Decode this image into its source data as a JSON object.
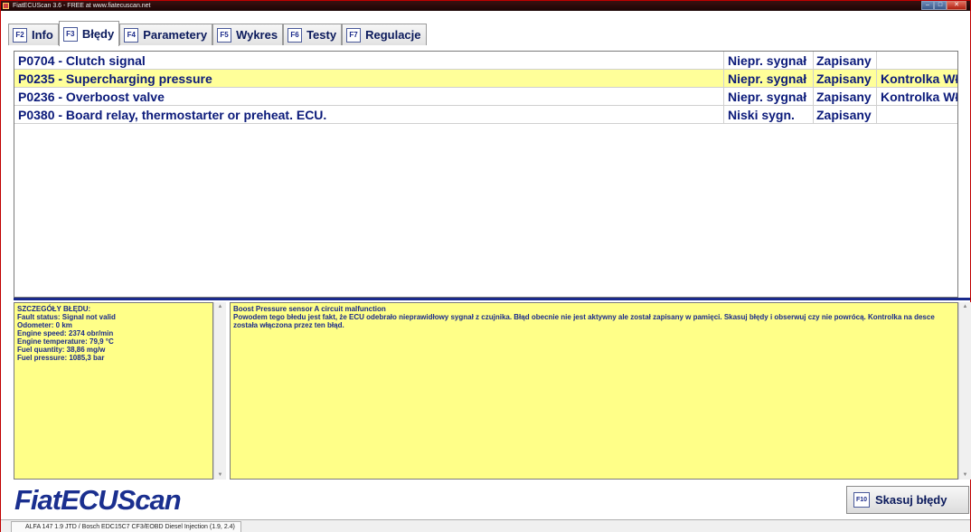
{
  "window": {
    "title": "FiatECUScan 3.6 - FREE at www.fiatecuscan.net",
    "buttons": [
      "minimize",
      "maximize",
      "close"
    ]
  },
  "tabs": [
    {
      "key": "F2",
      "label": "Info"
    },
    {
      "key": "F3",
      "label": "Błędy"
    },
    {
      "key": "F4",
      "label": "Parametery"
    },
    {
      "key": "F5",
      "label": "Wykres"
    },
    {
      "key": "F6",
      "label": "Testy"
    },
    {
      "key": "F7",
      "label": "Regulacje"
    }
  ],
  "active_tab": "Błędy",
  "errors": [
    {
      "code_desc": "P0704 - Clutch signal",
      "signal": "Niepr. sygnał",
      "status": "Zapisany",
      "lamp": ""
    },
    {
      "code_desc": "P0235 - Supercharging pressure",
      "signal": "Niepr. sygnał",
      "status": "Zapisany",
      "lamp": "Kontrolka WŁ"
    },
    {
      "code_desc": "P0236 - Overboost valve",
      "signal": "Niepr. sygnał",
      "status": "Zapisany",
      "lamp": "Kontrolka WŁ"
    },
    {
      "code_desc": "P0380 - Board relay, thermostarter or preheat. ECU.",
      "signal": "Niski sygn.",
      "status": "Zapisany",
      "lamp": ""
    }
  ],
  "selected_error_index": 1,
  "details": {
    "header": "SZCZEGÓŁY BŁĘDU:",
    "lines": [
      "Fault status: Signal not valid",
      "Odometer: 0 km",
      "Engine speed: 2374 obr/min",
      "Engine temperature: 79,9 °C",
      "Fuel quantity: 38,86 mg/w",
      "Fuel pressure: 1085,3 bar"
    ]
  },
  "description": {
    "title": "Boost Pressure sensor A circuit malfunction",
    "text": "Powodem tego błedu jest fakt, że ECU odebrało nieprawidłowy sygnał z czujnika. Błąd obecnie nie jest aktywny ale został zapisany w pamięci. Skasuj błędy i obserwuj czy nie powrócą. Kontrolka na desce została włączona przez ten błąd."
  },
  "logo": "FiatECUScan",
  "clear_button": {
    "key": "F10",
    "label": "Skasuj błędy"
  },
  "statusbar": {
    "text": "ALFA 147 1.9 JTD / Bosch EDC15C7 CF3/EOBD Diesel Injection (1.9, 2.4)"
  },
  "colors": {
    "selected_row": "#ffff99",
    "detail_panel": "#ffff88",
    "text_blue": "#0b1a7a",
    "separator": "#1a2a8c"
  }
}
